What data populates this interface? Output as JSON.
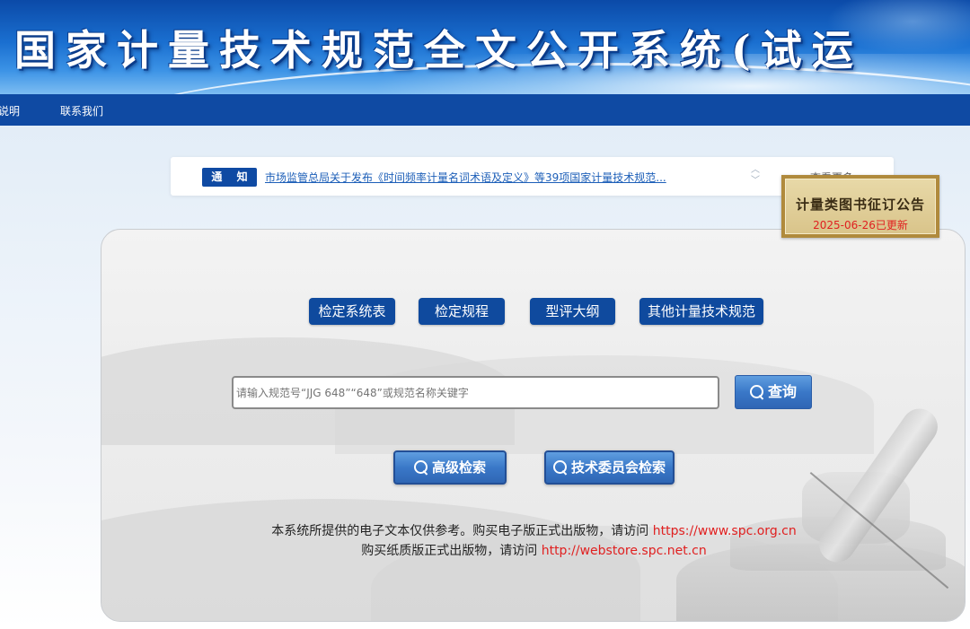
{
  "banner": {
    "title": "国家计量技术规范全文公开系统(试运"
  },
  "nav": {
    "items": [
      "说明",
      "联系我们"
    ]
  },
  "notice": {
    "tag": "通 知",
    "text": "市场监管总局关于发布《时间频率计量名词术语及定义》等39项国家计量技术规范...",
    "more": "查看更多"
  },
  "book_notice": {
    "title": "计量类图书征订公告",
    "date": "2025-06-26已更新"
  },
  "categories": [
    "检定系统表",
    "检定规程",
    "型评大纲",
    "其他计量技术规范"
  ],
  "search": {
    "placeholder": "请输入规范号“JJG 648”“648”或规范名称关键字",
    "button": "查询"
  },
  "advanced": {
    "advanced_search": "高级检索",
    "committee_search": "技术委员会检索"
  },
  "footer": {
    "line1_text": "本系统所提供的电子文本仅供参考。购买电子版正式出版物，请访问 ",
    "line1_link": "https://www.spc.org.cn",
    "line2_text": "购买纸质版正式出版物，请访问 ",
    "line2_link": "http://webstore.spc.net.cn"
  },
  "colors": {
    "nav_bg": "#0f4aa3",
    "category_bg": "#0f4a9e",
    "link_red": "#e02020"
  }
}
